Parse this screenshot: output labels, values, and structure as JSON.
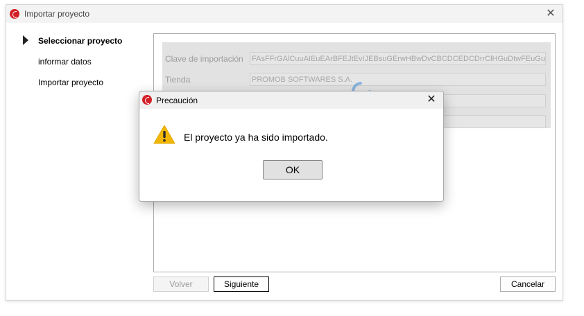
{
  "window": {
    "title": "Importar proyecto"
  },
  "steps": [
    {
      "label": "Seleccionar proyecto",
      "active": true
    },
    {
      "label": "informar datos",
      "active": false
    },
    {
      "label": "Importar proyecto",
      "active": false
    }
  ],
  "form": {
    "fields": [
      {
        "label": "Clave de importación",
        "value": "FAsFFrGAlCuuAIEuEArBFEJtEvIJEBsuGErwHBwDvCBCDCEDCDrrClHGuDtwFEuGuB"
      },
      {
        "label": "Tienda",
        "value": "PROMOB SOFTWARES S.A."
      },
      {
        "label": "",
        "value": ""
      },
      {
        "label": "",
        "value": ""
      }
    ],
    "loading": true
  },
  "buttons": {
    "back": "Volver",
    "next": "Siguiente",
    "cancel": "Cancelar"
  },
  "dialog": {
    "title": "Precaución",
    "message": "El proyecto ya ha sido importado.",
    "ok": "OK",
    "icon": "warning-icon"
  },
  "colors": {
    "brand": "#d32027",
    "warning": "#f2b705",
    "spinner": "#6aa3d8"
  }
}
